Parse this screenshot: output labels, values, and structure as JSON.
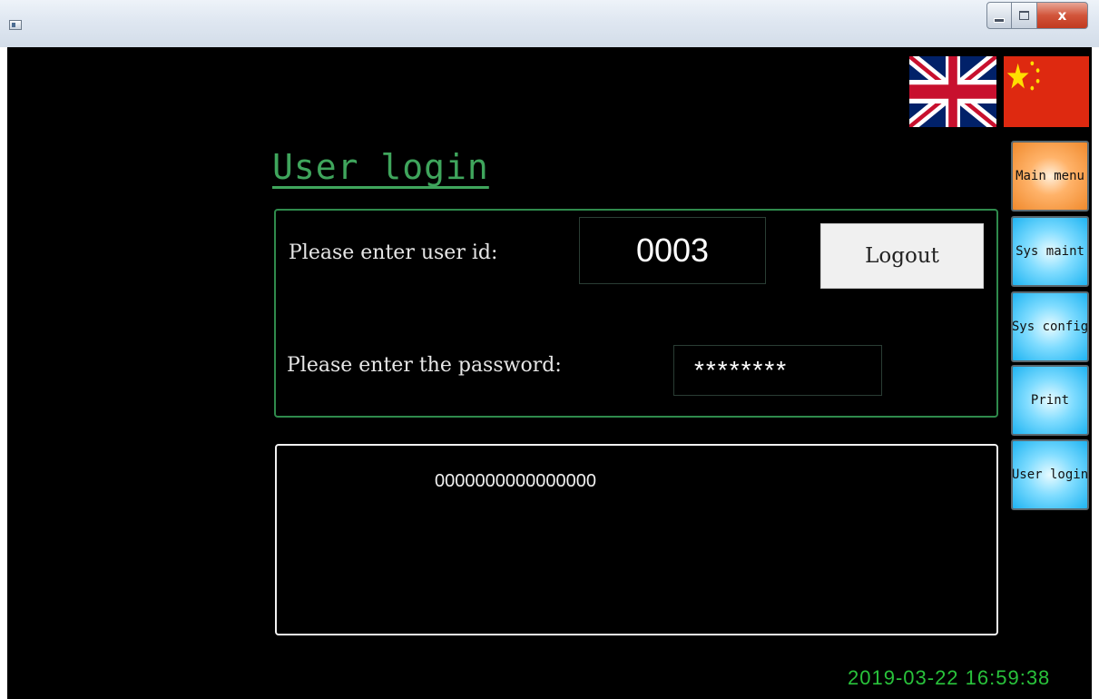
{
  "window": {
    "close_glyph": "x"
  },
  "page": {
    "title": "User login"
  },
  "login": {
    "user_id_label": "Please enter user id:",
    "user_id_value": "0003",
    "password_label": "Please enter the password:",
    "password_value": "********",
    "logout_label": "Logout"
  },
  "message": {
    "text": "0000000000000000"
  },
  "nav": {
    "items": [
      {
        "label": "Main menu",
        "color": "#f08a2d"
      },
      {
        "label": "Sys maint",
        "color": "#1fb4f2"
      },
      {
        "label": "Sys config",
        "color": "#1fb4f2"
      },
      {
        "label": "Print",
        "color": "#1fb4f2"
      },
      {
        "label": "User login",
        "color": "#1fb4f2"
      }
    ]
  },
  "status": {
    "datetime": "2019-03-22 16:59:38"
  },
  "colors": {
    "accent_green": "#3fa55c",
    "clock_green": "#29c23b",
    "background": "#000000"
  }
}
